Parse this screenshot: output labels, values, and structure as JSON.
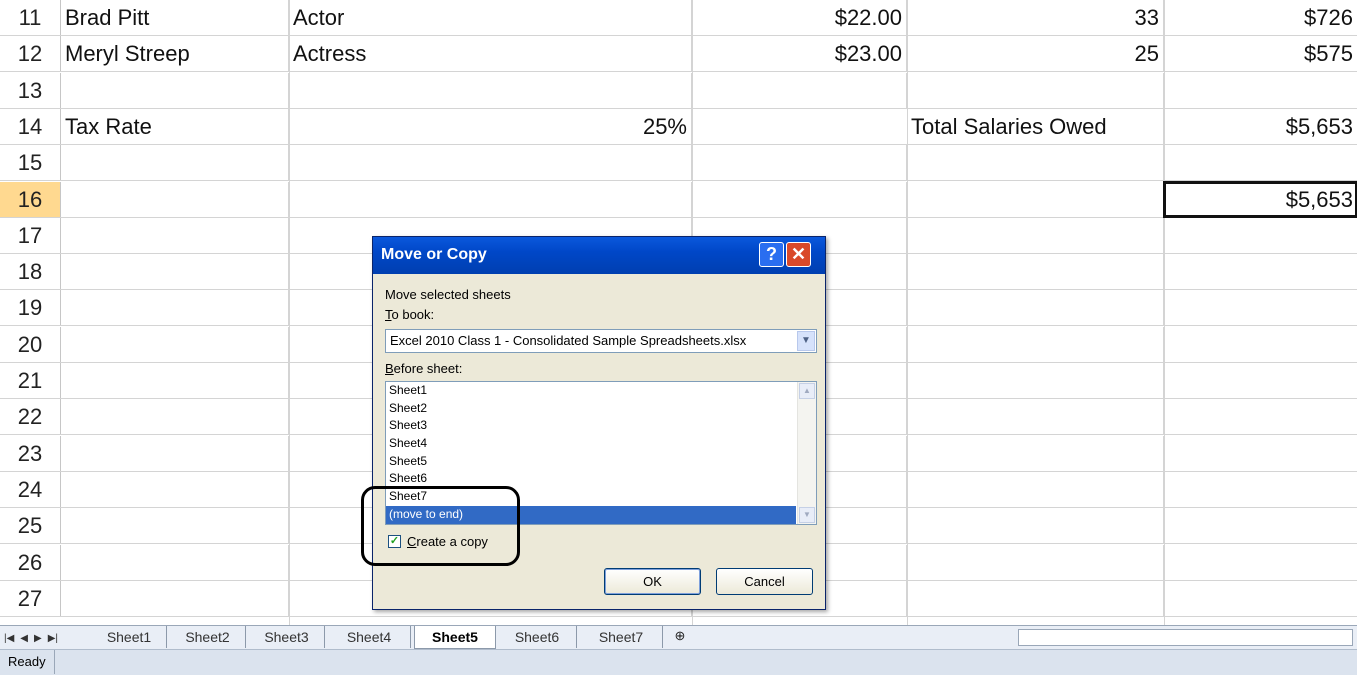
{
  "sheet": {
    "rows": [
      {
        "num": "11",
        "a": "Brad Pitt",
        "b": "Actor",
        "c": "",
        "d": "$22.00",
        "e": "33",
        "f": "$726"
      },
      {
        "num": "12",
        "a": "Meryl Streep",
        "b": "Actress",
        "c": "",
        "d": "$23.00",
        "e": "25",
        "f": "$575"
      },
      {
        "num": "13",
        "a": "",
        "b": "",
        "c": "",
        "d": "",
        "e": "",
        "f": ""
      },
      {
        "num": "14",
        "a": "Tax Rate",
        "b": "",
        "c": "25%",
        "d": "",
        "e": "Total Salaries Owed",
        "f": "$5,653"
      },
      {
        "num": "15",
        "a": "",
        "b": "",
        "c": "",
        "d": "",
        "e": "",
        "f": ""
      },
      {
        "num": "16",
        "a": "",
        "b": "",
        "c": "",
        "d": "",
        "e": "",
        "f": "$5,653"
      },
      {
        "num": "17"
      },
      {
        "num": "18"
      },
      {
        "num": "19"
      },
      {
        "num": "20"
      },
      {
        "num": "21"
      },
      {
        "num": "22"
      },
      {
        "num": "23"
      },
      {
        "num": "24"
      },
      {
        "num": "25"
      },
      {
        "num": "26"
      },
      {
        "num": "27"
      }
    ],
    "selected_row": "16"
  },
  "tabs": {
    "items": [
      "Sheet1",
      "Sheet2",
      "Sheet3",
      "Sheet4",
      "Sheet5",
      "Sheet6",
      "Sheet7"
    ],
    "active": "Sheet5"
  },
  "status": {
    "text": "Ready"
  },
  "dialog": {
    "title": "Move or Copy",
    "help_glyph": "?",
    "close_glyph": "✕",
    "move_selected_label": "Move selected sheets",
    "to_book_label": "To book:",
    "to_book_value": "Excel 2010 Class 1 - Consolidated Sample Spreadsheets.xlsx",
    "before_sheet_label": "Before sheet:",
    "before_sheet_options": [
      "Sheet1",
      "Sheet2",
      "Sheet3",
      "Sheet4",
      "Sheet5",
      "Sheet6",
      "Sheet7",
      "(move to end)"
    ],
    "selected_option": "(move to end)",
    "create_copy_label": "Create a copy",
    "create_copy_checked": true,
    "ok_label": "OK",
    "cancel_label": "Cancel"
  },
  "colors": {
    "titlebar": "#0047c8",
    "selection": "#316ac5",
    "active_row_header": "#ffd990"
  }
}
